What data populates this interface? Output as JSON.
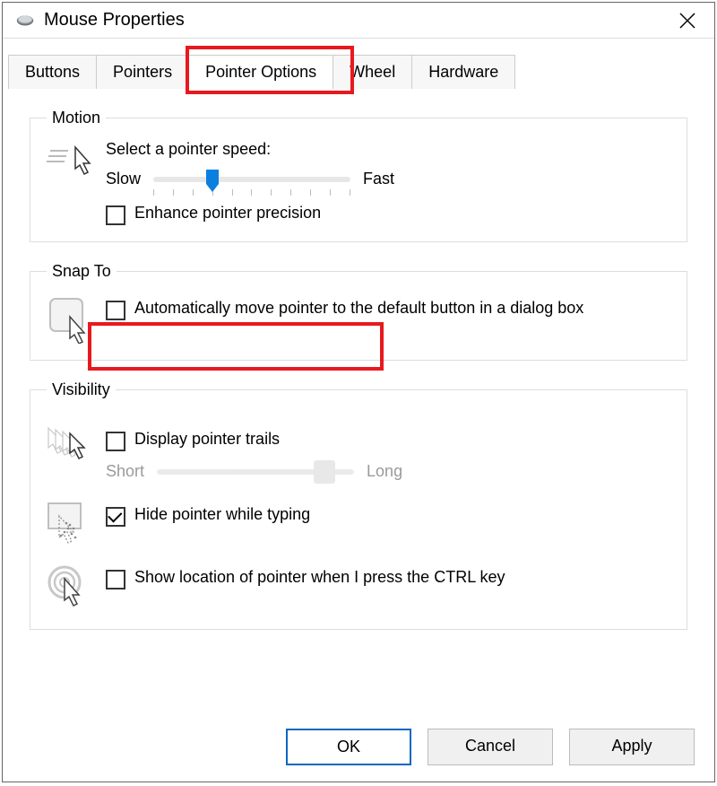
{
  "window": {
    "title": "Mouse Properties"
  },
  "tabs": [
    {
      "label": "Buttons"
    },
    {
      "label": "Pointers"
    },
    {
      "label": "Pointer Options",
      "active": true
    },
    {
      "label": "Wheel"
    },
    {
      "label": "Hardware"
    }
  ],
  "motion": {
    "legend": "Motion",
    "prompt": "Select a pointer speed:",
    "slow_label": "Slow",
    "fast_label": "Fast",
    "slider_pct": 30,
    "enhance_label": "Enhance pointer precision",
    "enhance_checked": false
  },
  "snapTo": {
    "legend": "Snap To",
    "auto_label": "Automatically move pointer to the default button in a dialog box",
    "auto_checked": false
  },
  "visibility": {
    "legend": "Visibility",
    "trails_label": "Display pointer trails",
    "trails_checked": false,
    "trails_short": "Short",
    "trails_long": "Long",
    "trails_slider_pct": 85,
    "hide_label": "Hide pointer while typing",
    "hide_checked": true,
    "ctrl_label": "Show location of pointer when I press the CTRL key",
    "ctrl_checked": false
  },
  "buttons": {
    "ok": "OK",
    "cancel": "Cancel",
    "apply": "Apply"
  }
}
